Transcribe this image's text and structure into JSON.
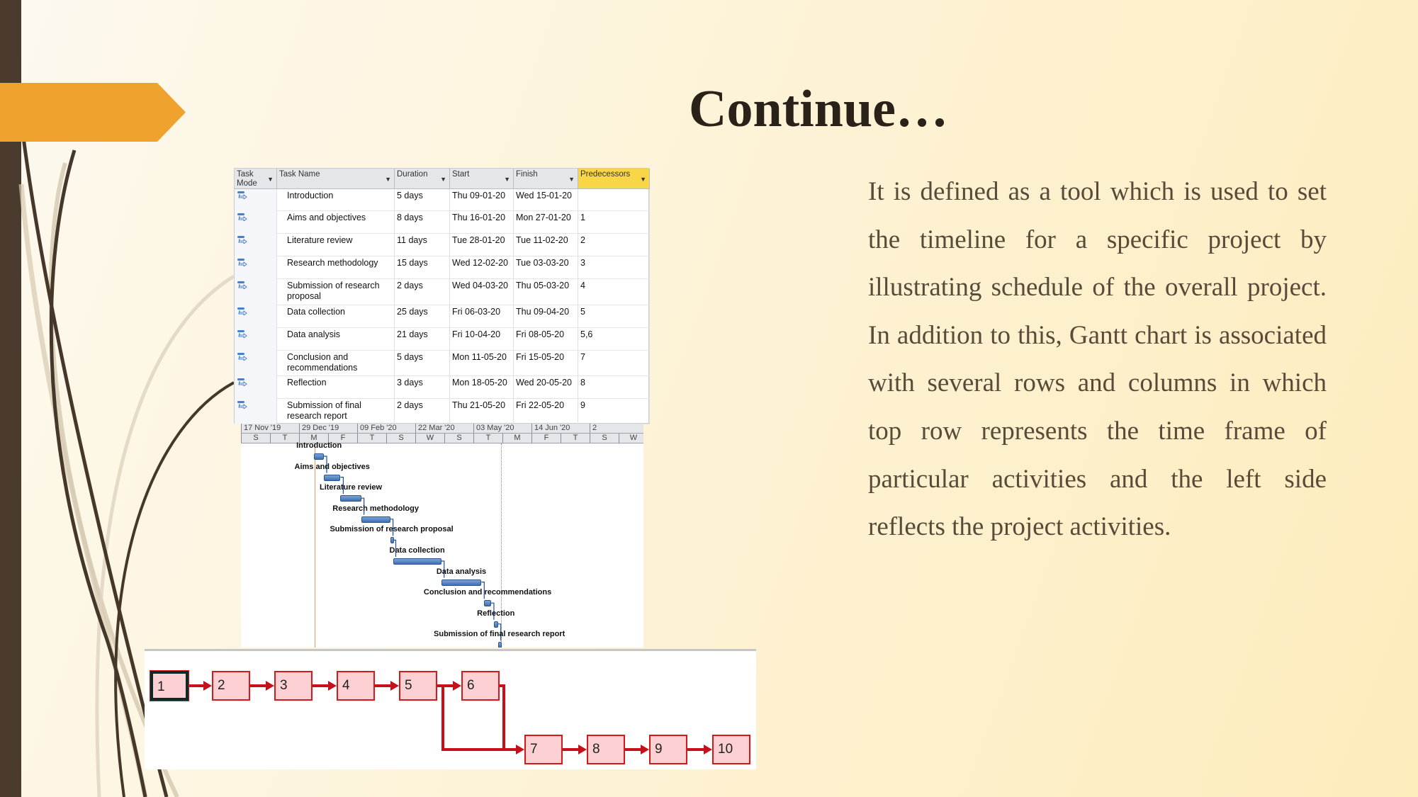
{
  "slide": {
    "title": "Continue…",
    "paragraph": "It is defined as a tool which is used to set the timeline for a specific project by illustrating schedule of the overall project. In addition to this, Gantt chart is associated with several rows and columns in which top row represents the time frame of particular activities and the left side reflects the project activities.",
    "colors": {
      "accent": "#f0a22e",
      "sidebar": "#4b3b2f",
      "title": "#2a2119",
      "gantt_bar": "#3d6fb3",
      "network_node": "#fdd0d3",
      "network_link": "#d31a1a"
    }
  },
  "table": {
    "headers": [
      "Task Mode",
      "Task Name",
      "Duration",
      "Start",
      "Finish",
      "Predecessors"
    ],
    "task_mode_icon": "auto-scheduled-task-icon",
    "rows": [
      {
        "name": "Introduction",
        "duration": "5 days",
        "start": "Thu 09-01-20",
        "finish": "Wed 15-01-20",
        "pred": ""
      },
      {
        "name": "Aims and objectives",
        "duration": "8 days",
        "start": "Thu 16-01-20",
        "finish": "Mon 27-01-20",
        "pred": "1"
      },
      {
        "name": "Literature review",
        "duration": "11 days",
        "start": "Tue 28-01-20",
        "finish": "Tue 11-02-20",
        "pred": "2"
      },
      {
        "name": "Research methodology",
        "duration": "15 days",
        "start": "Wed 12-02-20",
        "finish": "Tue 03-03-20",
        "pred": "3"
      },
      {
        "name": "Submission of research proposal",
        "duration": "2 days",
        "start": "Wed 04-03-20",
        "finish": "Thu 05-03-20",
        "pred": "4"
      },
      {
        "name": "Data collection",
        "duration": "25 days",
        "start": "Fri 06-03-20",
        "finish": "Thu 09-04-20",
        "pred": "5"
      },
      {
        "name": "Data analysis",
        "duration": "21 days",
        "start": "Fri 10-04-20",
        "finish": "Fri 08-05-20",
        "pred": "5,6"
      },
      {
        "name": "Conclusion and recommendations",
        "duration": "5 days",
        "start": "Mon 11-05-20",
        "finish": "Fri 15-05-20",
        "pred": "7"
      },
      {
        "name": "Reflection",
        "duration": "3 days",
        "start": "Mon 18-05-20",
        "finish": "Wed 20-05-20",
        "pred": "8"
      },
      {
        "name": "Submission of final research report",
        "duration": "2 days",
        "start": "Thu 21-05-20",
        "finish": "Fri 22-05-20",
        "pred": "9"
      }
    ]
  },
  "gantt": {
    "major_ticks": [
      "17 Nov '19",
      "29 Dec '19",
      "09 Feb '20",
      "22 Mar '20",
      "03 May '20",
      "14 Jun '20",
      "2"
    ],
    "minor_ticks": [
      "S",
      "T",
      "M",
      "F",
      "T",
      "S",
      "W",
      "S",
      "T",
      "M",
      "F",
      "T",
      "S",
      "W"
    ]
  },
  "network": {
    "nodes": [
      "1",
      "2",
      "3",
      "4",
      "5",
      "6",
      "7",
      "8",
      "9",
      "10"
    ],
    "selected": "1"
  }
}
